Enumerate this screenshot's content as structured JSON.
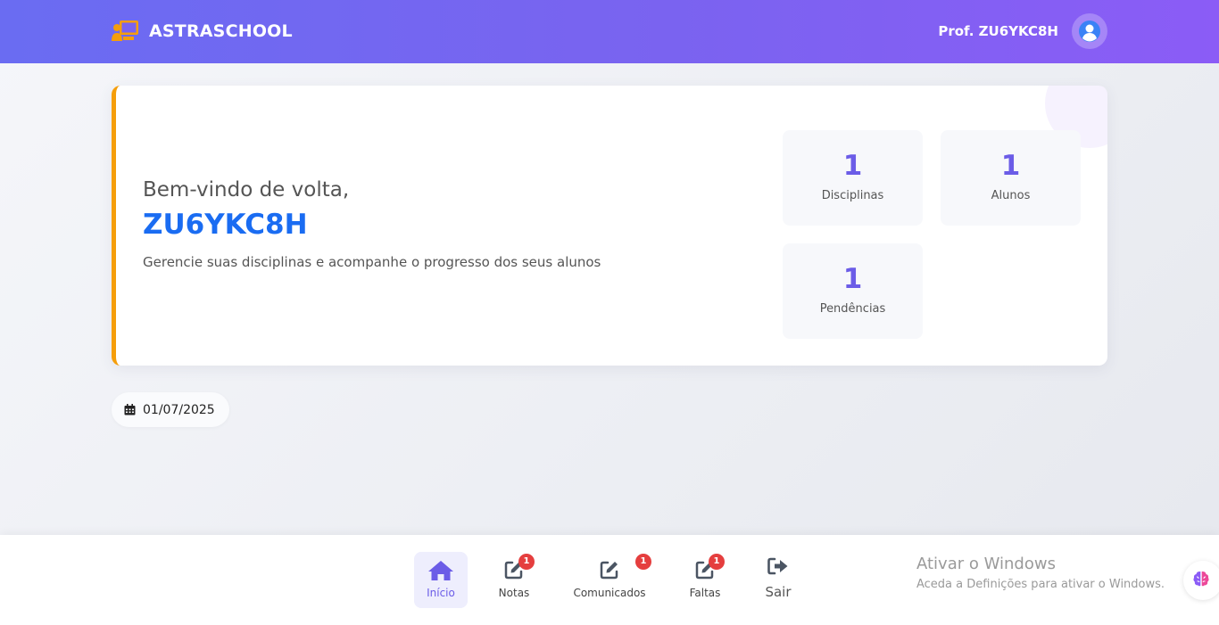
{
  "header": {
    "brand": "ASTRASCHOOL",
    "user_name": "Prof. ZU6YKC8H"
  },
  "welcome": {
    "greeting": "Bem-vindo de volta,",
    "username": "ZU6YKC8H",
    "subtitle": "Gerencie suas disciplinas e acompanhe o progresso dos seus alunos"
  },
  "stats": [
    {
      "value": "1",
      "label": "Disciplinas"
    },
    {
      "value": "1",
      "label": "Alunos"
    },
    {
      "value": "1",
      "label": "Pendências"
    }
  ],
  "date": "01/07/2025",
  "nav": [
    {
      "label": "Início",
      "icon": "home-icon",
      "active": true
    },
    {
      "label": "Notas",
      "icon": "edit-icon",
      "badge": "1"
    },
    {
      "label": "Comunicados",
      "icon": "edit-icon",
      "badge": "1"
    },
    {
      "label": "Faltas",
      "icon": "edit-icon",
      "badge": "1"
    },
    {
      "label": "Sair",
      "icon": "logout-icon"
    }
  ],
  "watermark": {
    "title": "Ativar o Windows",
    "subtitle": "Aceda a Definições para ativar o Windows."
  },
  "colors": {
    "header_start": "#6a6cf2",
    "header_end": "#8b5cf6",
    "accent": "#6b5ce7",
    "username": "#1a6cf2",
    "card_border": "#f59e0b",
    "badge": "#e53e3e"
  }
}
